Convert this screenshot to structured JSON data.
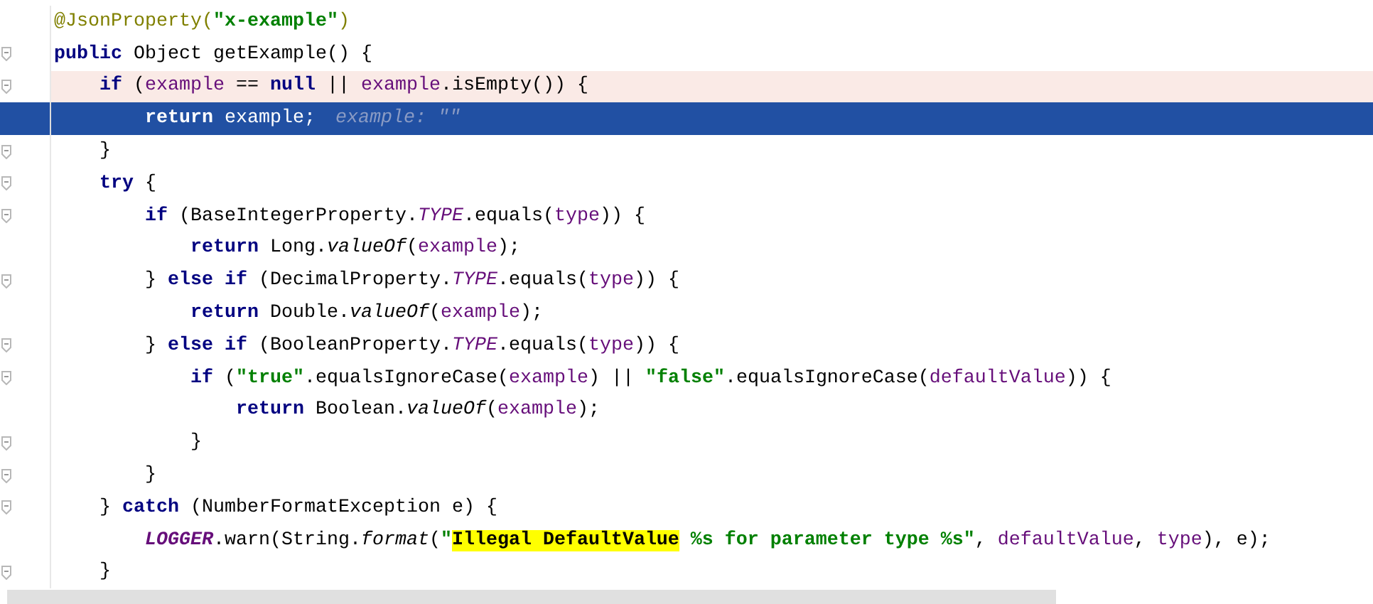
{
  "editor": {
    "lines": [
      {
        "kind": "plain",
        "fold_marker": false,
        "tokens": [
          {
            "kind": "annotation",
            "text": "@JsonProperty("
          },
          {
            "kind": "string",
            "text": "\"x-example\""
          },
          {
            "kind": "annotation",
            "text": ")"
          }
        ]
      },
      {
        "kind": "plain",
        "fold_marker": true,
        "tokens": [
          {
            "kind": "keyword",
            "text": "public "
          },
          {
            "kind": "plain",
            "text": "Object getExample() {"
          }
        ]
      },
      {
        "kind": "marked",
        "fold_marker": true,
        "tokens": [
          {
            "kind": "keyword",
            "text": "    if "
          },
          {
            "kind": "plain",
            "text": "("
          },
          {
            "kind": "field",
            "text": "example"
          },
          {
            "kind": "plain",
            "text": " == "
          },
          {
            "kind": "keyword",
            "text": "null"
          },
          {
            "kind": "plain",
            "text": " || "
          },
          {
            "kind": "field",
            "text": "example"
          },
          {
            "kind": "plain",
            "text": ".isEmpty()) {"
          }
        ]
      },
      {
        "kind": "selected",
        "fold_marker": false,
        "tokens": [
          {
            "kind": "keyword",
            "text": "        return "
          },
          {
            "kind": "field",
            "text": "example"
          },
          {
            "kind": "plain",
            "text": ";"
          }
        ],
        "hint": "example: \"\""
      },
      {
        "kind": "plain",
        "fold_marker": true,
        "tokens": [
          {
            "kind": "plain",
            "text": "    }"
          }
        ]
      },
      {
        "kind": "plain",
        "fold_marker": true,
        "tokens": [
          {
            "kind": "keyword",
            "text": "    try"
          },
          {
            "kind": "plain",
            "text": " {"
          }
        ]
      },
      {
        "kind": "plain",
        "fold_marker": true,
        "tokens": [
          {
            "kind": "keyword",
            "text": "        if "
          },
          {
            "kind": "plain",
            "text": "(BaseIntegerProperty."
          },
          {
            "kind": "static_field",
            "text": "TYPE"
          },
          {
            "kind": "plain",
            "text": ".equals("
          },
          {
            "kind": "field",
            "text": "type"
          },
          {
            "kind": "plain",
            "text": ")) {"
          }
        ]
      },
      {
        "kind": "plain",
        "fold_marker": false,
        "tokens": [
          {
            "kind": "keyword",
            "text": "            return "
          },
          {
            "kind": "plain",
            "text": "Long."
          },
          {
            "kind": "static_method",
            "text": "valueOf"
          },
          {
            "kind": "plain",
            "text": "("
          },
          {
            "kind": "field",
            "text": "example"
          },
          {
            "kind": "plain",
            "text": ");"
          }
        ]
      },
      {
        "kind": "plain",
        "fold_marker": true,
        "tokens": [
          {
            "kind": "plain",
            "text": "        } "
          },
          {
            "kind": "keyword",
            "text": "else if "
          },
          {
            "kind": "plain",
            "text": "(DecimalProperty."
          },
          {
            "kind": "static_field",
            "text": "TYPE"
          },
          {
            "kind": "plain",
            "text": ".equals("
          },
          {
            "kind": "field",
            "text": "type"
          },
          {
            "kind": "plain",
            "text": ")) {"
          }
        ]
      },
      {
        "kind": "plain",
        "fold_marker": false,
        "tokens": [
          {
            "kind": "keyword",
            "text": "            return "
          },
          {
            "kind": "plain",
            "text": "Double."
          },
          {
            "kind": "static_method",
            "text": "valueOf"
          },
          {
            "kind": "plain",
            "text": "("
          },
          {
            "kind": "field",
            "text": "example"
          },
          {
            "kind": "plain",
            "text": ");"
          }
        ]
      },
      {
        "kind": "plain",
        "fold_marker": true,
        "tokens": [
          {
            "kind": "plain",
            "text": "        } "
          },
          {
            "kind": "keyword",
            "text": "else if "
          },
          {
            "kind": "plain",
            "text": "(BooleanProperty."
          },
          {
            "kind": "static_field",
            "text": "TYPE"
          },
          {
            "kind": "plain",
            "text": ".equals("
          },
          {
            "kind": "field",
            "text": "type"
          },
          {
            "kind": "plain",
            "text": ")) {"
          }
        ]
      },
      {
        "kind": "plain",
        "fold_marker": true,
        "tokens": [
          {
            "kind": "keyword",
            "text": "            if "
          },
          {
            "kind": "plain",
            "text": "("
          },
          {
            "kind": "string",
            "text": "\"true\""
          },
          {
            "kind": "plain",
            "text": ".equalsIgnoreCase("
          },
          {
            "kind": "field",
            "text": "example"
          },
          {
            "kind": "plain",
            "text": ") || "
          },
          {
            "kind": "string",
            "text": "\"false\""
          },
          {
            "kind": "plain",
            "text": ".equalsIgnoreCase("
          },
          {
            "kind": "field",
            "text": "defaultValue"
          },
          {
            "kind": "plain",
            "text": ")) {"
          }
        ]
      },
      {
        "kind": "plain",
        "fold_marker": false,
        "tokens": [
          {
            "kind": "keyword",
            "text": "                return "
          },
          {
            "kind": "plain",
            "text": "Boolean."
          },
          {
            "kind": "static_method",
            "text": "valueOf"
          },
          {
            "kind": "plain",
            "text": "("
          },
          {
            "kind": "field",
            "text": "example"
          },
          {
            "kind": "plain",
            "text": ");"
          }
        ]
      },
      {
        "kind": "plain",
        "fold_marker": true,
        "tokens": [
          {
            "kind": "plain",
            "text": "            }"
          }
        ]
      },
      {
        "kind": "plain",
        "fold_marker": true,
        "tokens": [
          {
            "kind": "plain",
            "text": "        }"
          }
        ]
      },
      {
        "kind": "plain",
        "fold_marker": true,
        "tokens": [
          {
            "kind": "plain",
            "text": "    } "
          },
          {
            "kind": "keyword",
            "text": "catch "
          },
          {
            "kind": "plain",
            "text": "(NumberFormatException e) {"
          }
        ]
      },
      {
        "kind": "plain",
        "fold_marker": false,
        "tokens": [
          {
            "kind": "static_constant",
            "text": "        LOGGER"
          },
          {
            "kind": "plain",
            "text": ".warn(String."
          },
          {
            "kind": "static_method",
            "text": "format"
          },
          {
            "kind": "plain",
            "text": "("
          },
          {
            "kind": "string",
            "text": "\""
          },
          {
            "kind": "match",
            "text": "Illegal DefaultValue"
          },
          {
            "kind": "string",
            "text": " %s for parameter type %s\""
          },
          {
            "kind": "plain",
            "text": ", "
          },
          {
            "kind": "field",
            "text": "defaultValue"
          },
          {
            "kind": "plain",
            "text": ", "
          },
          {
            "kind": "field",
            "text": "type"
          },
          {
            "kind": "plain",
            "text": "), e);"
          }
        ]
      },
      {
        "kind": "plain",
        "fold_marker": true,
        "tokens": [
          {
            "kind": "plain",
            "text": "    }"
          }
        ]
      }
    ]
  }
}
